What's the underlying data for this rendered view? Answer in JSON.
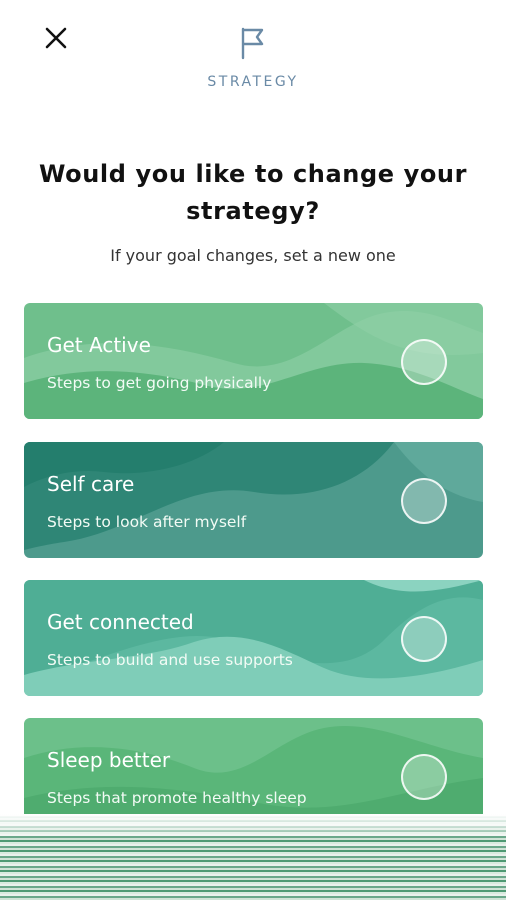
{
  "header": {
    "close_icon": "close-icon",
    "flag_icon": "flag-icon",
    "label": "STRATEGY"
  },
  "main": {
    "title": "Would you like to change your strategy?",
    "subtitle": "If your goal changes, set a new one"
  },
  "strategies": [
    {
      "title": "Get Active",
      "description": "Steps to get going physically",
      "selected": false
    },
    {
      "title": "Self care",
      "description": "Steps to look after myself",
      "selected": false
    },
    {
      "title": "Get connected",
      "description": "Steps to build and use supports",
      "selected": false
    },
    {
      "title": "Sleep better",
      "description": "Steps that promote healthy sleep",
      "selected": false
    }
  ],
  "colors": {
    "get_active": "#71c08f",
    "self_care": "#4e9c8f",
    "get_connected": "#6dc4ad",
    "sleep_better": "#5fb77c",
    "header_label": "#6a8aa6"
  }
}
